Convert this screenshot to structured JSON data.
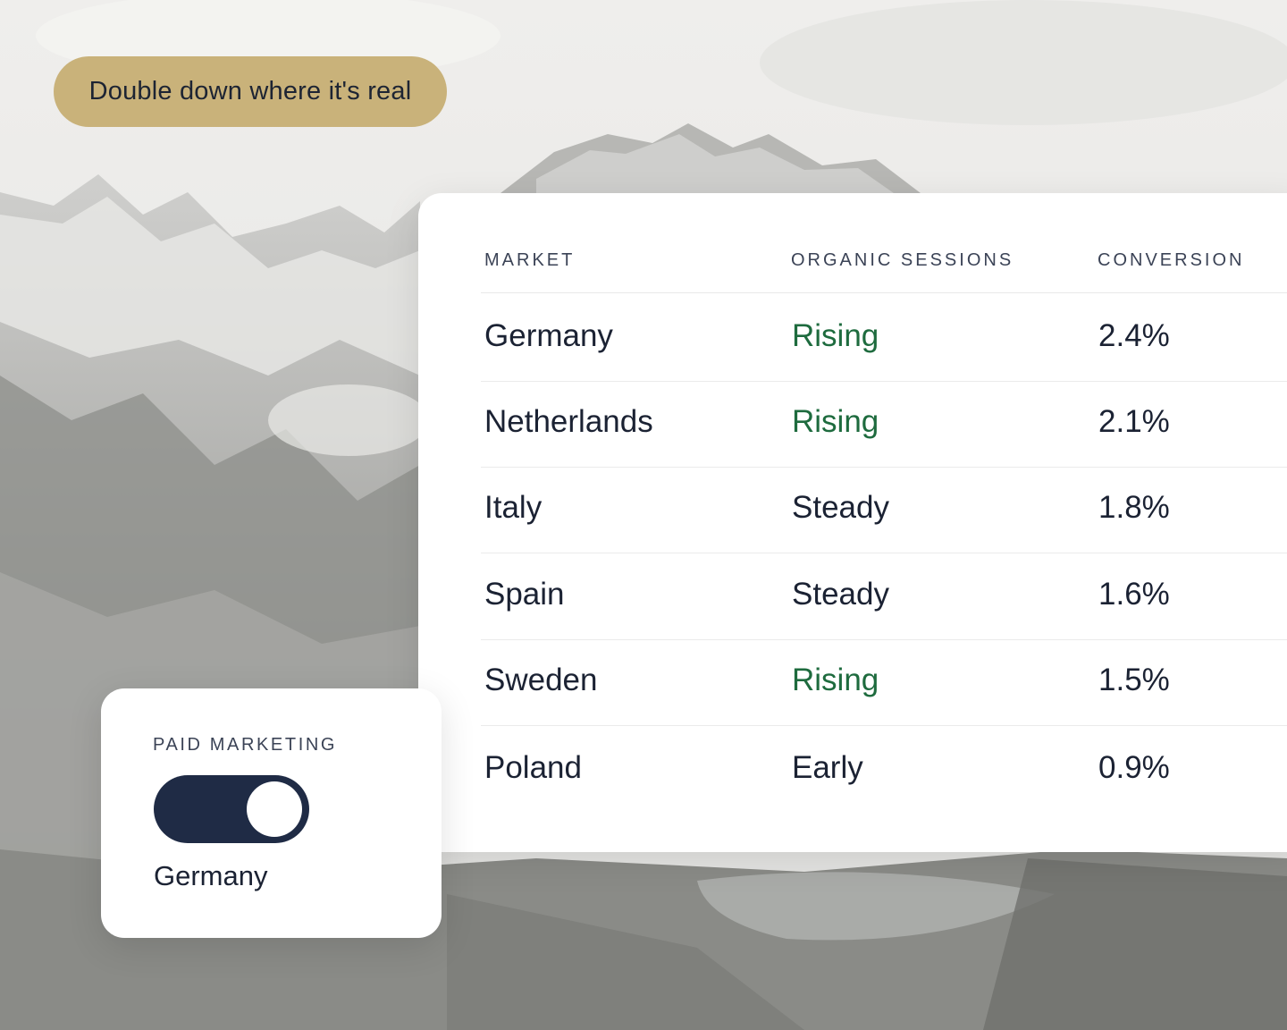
{
  "badge": {
    "text": "Double down where it's real"
  },
  "table": {
    "headers": [
      "MARKET",
      "ORGANIC SESSIONS",
      "CONVERSION"
    ],
    "rows": [
      {
        "market": "Germany",
        "sessions": "Rising",
        "conversion": "2.4%"
      },
      {
        "market": "Netherlands",
        "sessions": "Rising",
        "conversion": "2.1%"
      },
      {
        "market": "Italy",
        "sessions": "Steady",
        "conversion": "1.8%"
      },
      {
        "market": "Spain",
        "sessions": "Steady",
        "conversion": "1.6%"
      },
      {
        "market": "Sweden",
        "sessions": "Rising",
        "conversion": "1.5%"
      },
      {
        "market": "Poland",
        "sessions": "Early",
        "conversion": "0.9%"
      }
    ]
  },
  "toggle": {
    "label": "PAID MARKETING",
    "state": "on",
    "value": "Germany"
  },
  "colors": {
    "badge": "#c9b27a",
    "rising": "#1e6b3e",
    "toggle_track": "#1f2b45",
    "text": "#1b2233"
  }
}
